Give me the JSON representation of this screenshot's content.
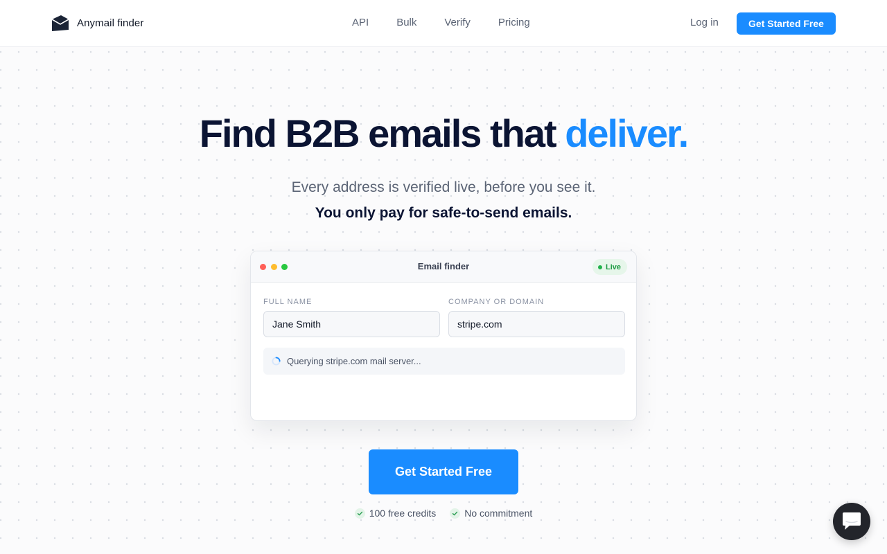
{
  "brand": {
    "name": "Anymail finder",
    "logo_icon": "envelope-logo-icon"
  },
  "nav": {
    "items": [
      "API",
      "Bulk",
      "Verify",
      "Pricing"
    ]
  },
  "header": {
    "login": "Log in",
    "cta": "Get Started Free"
  },
  "hero": {
    "title_main": "Find B2B emails that",
    "title_accent": "deliver.",
    "subtitle": "Every address is verified live, before you see it.",
    "subtitle_bold": "You only pay for safe-to-send emails."
  },
  "finder": {
    "title": "Email finder",
    "status_badge": "Live",
    "name_label": "FULL NAME",
    "name_value": "Jane Smith",
    "company_label": "COMPANY OR DOMAIN",
    "company_value": "stripe.com",
    "status_text": "Querying stripe.com mail server..."
  },
  "cta": {
    "label": "Get Started Free"
  },
  "perks": [
    "100 free credits",
    "No commitment"
  ],
  "chat": {
    "icon": "chat-bubble-icon"
  },
  "colors": {
    "accent": "#1a8cff",
    "heading": "#0b1433",
    "live": "#1f9d45"
  }
}
